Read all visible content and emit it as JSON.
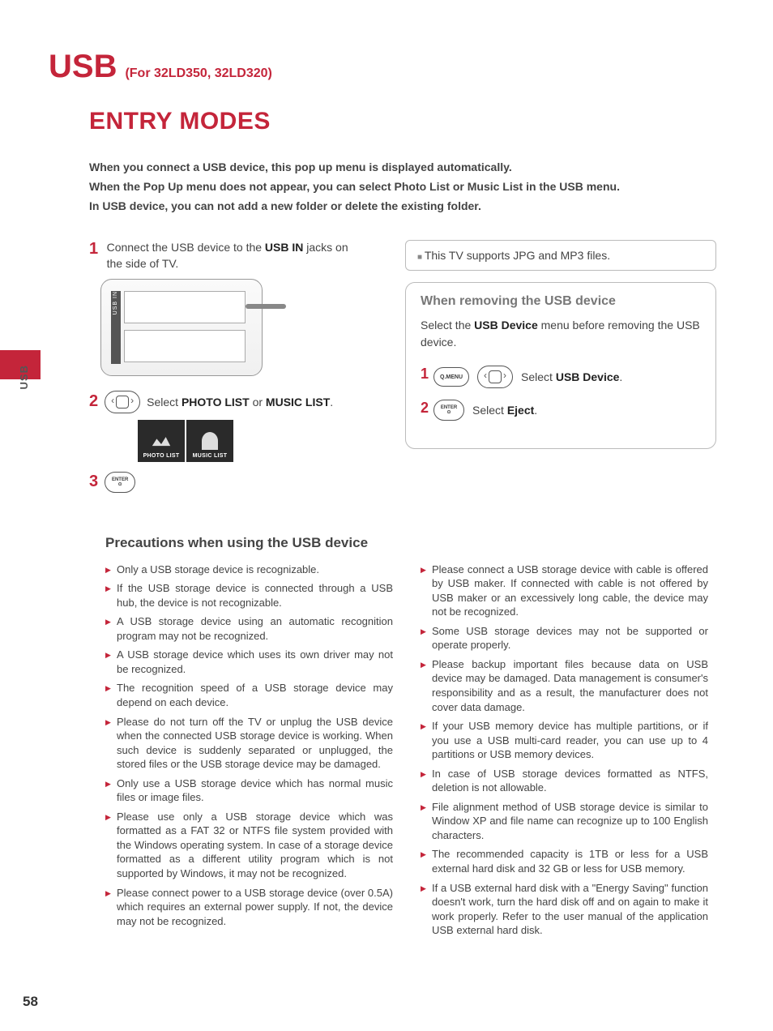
{
  "header": {
    "title": "USB",
    "models": "(For 32LD350, 32LD320)"
  },
  "section_title": "ENTRY MODES",
  "intro": {
    "line1": "When you connect a USB device, this pop up menu is displayed automatically.",
    "line2": "When the Pop Up menu does not appear, you can select Photo List or Music List in the USB menu.",
    "line3": "In USB device, you can not add a new folder or delete the existing folder."
  },
  "steps": {
    "s1_pre": "Connect the USB device to the ",
    "s1_bold": "USB IN",
    "s1_post": " jacks on the side of TV.",
    "port_label": "USB IN",
    "s2_pre": "Select ",
    "s2_b1": "PHOTO LIST",
    "s2_mid": " or ",
    "s2_b2": "MUSIC LIST",
    "s2_post": ".",
    "tile1": "PHOTO LIST",
    "tile2": "MUSIC LIST",
    "enter": "ENTER"
  },
  "note": "This TV supports JPG and MP3 files.",
  "remove": {
    "title": "When removing the USB device",
    "text_pre": "Select the ",
    "text_bold": "USB Device",
    "text_post": " menu before removing the USB device.",
    "qmenu": "Q.MENU",
    "r1_pre": "Select ",
    "r1_bold": "USB Device",
    "r1_post": ".",
    "r2_pre": "Select ",
    "r2_bold": "Eject",
    "r2_post": ".",
    "enter": "ENTER"
  },
  "sidetab": "USB",
  "precautions": {
    "title": "Precautions when using the USB device",
    "left": [
      "Only a USB storage device is recognizable.",
      "If the USB storage device is connected through a USB hub, the device is not recognizable.",
      "A USB storage device using an automatic recognition program may not be recognized.",
      "A USB storage device which uses its own driver may not be recognized.",
      "The recognition speed of a USB storage device may depend on each device.",
      "Please do not turn off the TV or unplug the USB device when the connected USB storage device is working.  When such device is suddenly separated or unplugged, the stored files or the USB storage device may be damaged.",
      "Only use a USB storage device which has normal music files or image files.",
      "Please use only a USB storage device which was formatted as a FAT 32 or NTFS file system provided with the Windows operating system.  In case of a storage device formatted as a different utility program which is not supported by Windows, it may not be recognized.",
      "Please connect power to a USB storage device (over 0.5A) which requires an external power supply.  If not, the device may not be recognized."
    ],
    "right": [
      "Please connect a USB storage device with cable is offered by USB maker.  If connected with cable is not offered by USB maker or an excessively long cable, the device may not be recognized.",
      "Some USB storage devices may not be supported or operate properly.",
      "Please backup important files because data on USB device may be damaged. Data management is consumer's responsibility and as a result, the manufacturer does not cover data damage.",
      "If your USB memory device has multiple partitions, or if you use a USB multi-card reader, you can use up to 4 partitions or USB memory devices.",
      "In case of USB storage devices formatted as NTFS, deletion is not allowable.",
      "File alignment method of USB storage device is similar to Window XP and file name can recognize up to 100 English characters.",
      "The recommended capacity is 1TB or less for a USB external hard disk and 32 GB or less for USB memory.",
      "If a USB external hard disk with a \"Energy Saving\" function doesn't work, turn the hard disk off and on again to make it work properly. Refer to the user manual of the application USB external hard disk."
    ]
  },
  "pagenum": "58"
}
